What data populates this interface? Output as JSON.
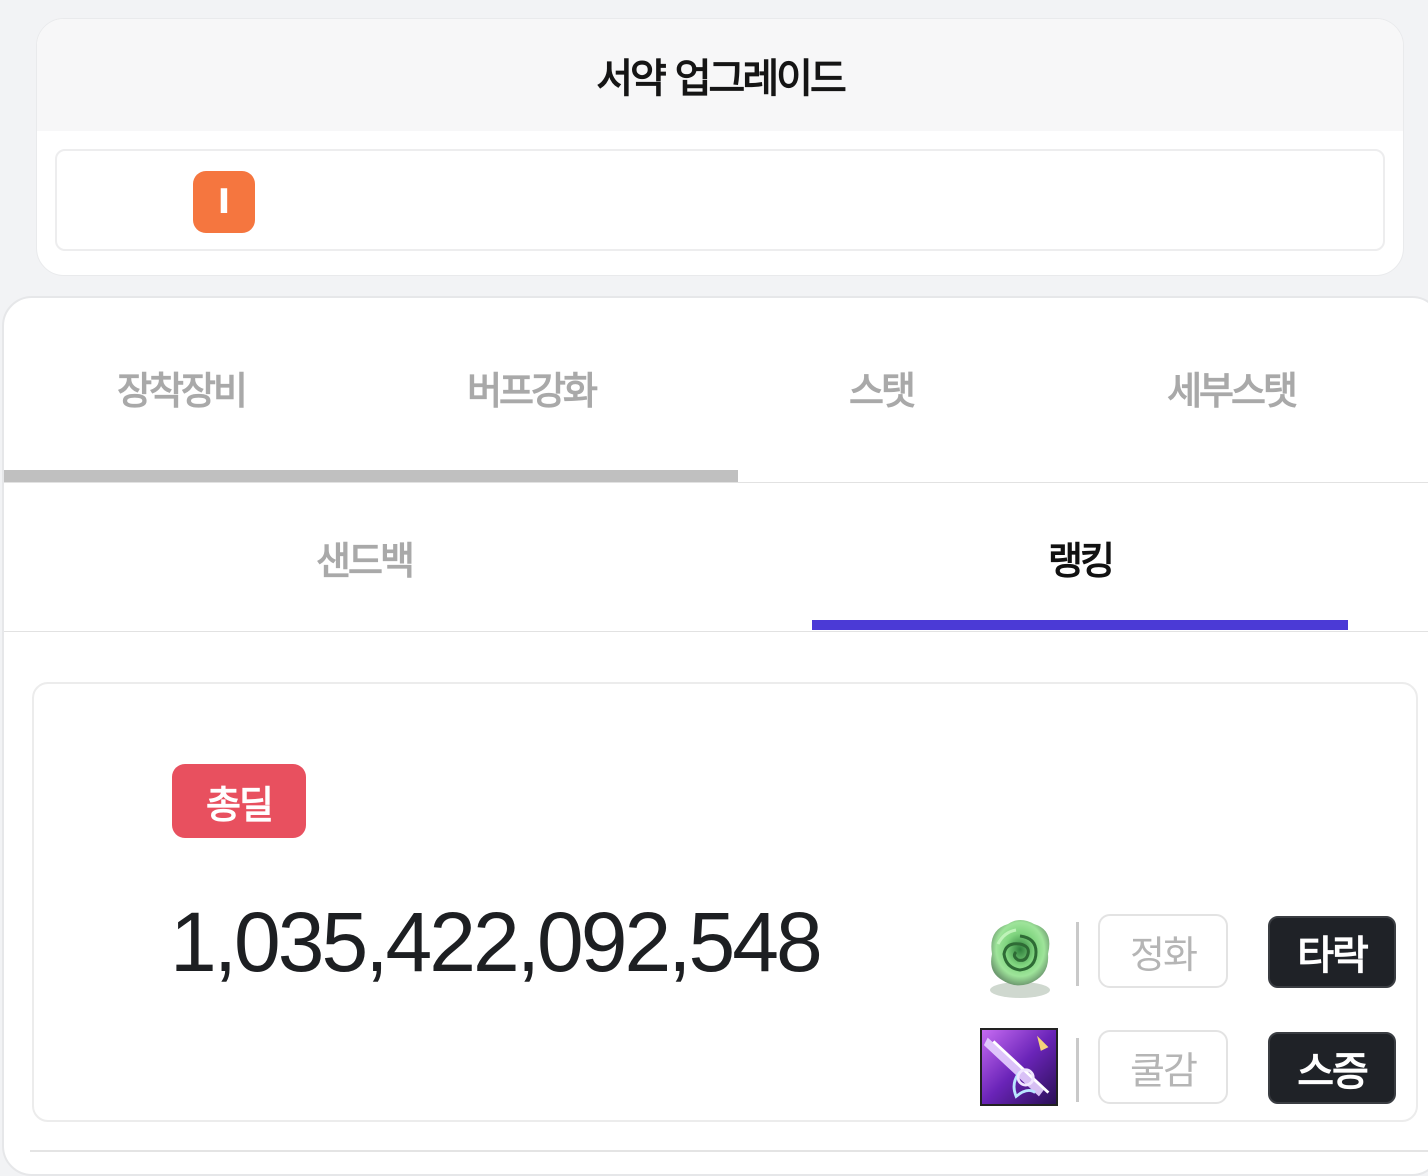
{
  "header": {
    "title": "서약 업그레이드"
  },
  "upgrade": {
    "level_badge": "I",
    "badge_color": "#f5763f"
  },
  "main_tabs": [
    {
      "label": "장착장비"
    },
    {
      "label": "버프강화"
    },
    {
      "label": "스탯"
    },
    {
      "label": "세부스탯"
    }
  ],
  "sub_tabs": [
    {
      "label": "샌드백",
      "active": false
    },
    {
      "label": "랭킹",
      "active": true
    }
  ],
  "ranking": {
    "badge": "총딜",
    "badge_color": "#e8505f",
    "damage_value": "1,035,422,092,548",
    "rows": [
      {
        "icon": "green-rose-emblem-icon",
        "option": "정화",
        "button": "타락"
      },
      {
        "icon": "purple-weapon-icon",
        "option": "쿨감",
        "button": "스증"
      }
    ]
  },
  "colors": {
    "accent": "#4b3ad6",
    "dark_button": "#1f2227"
  }
}
